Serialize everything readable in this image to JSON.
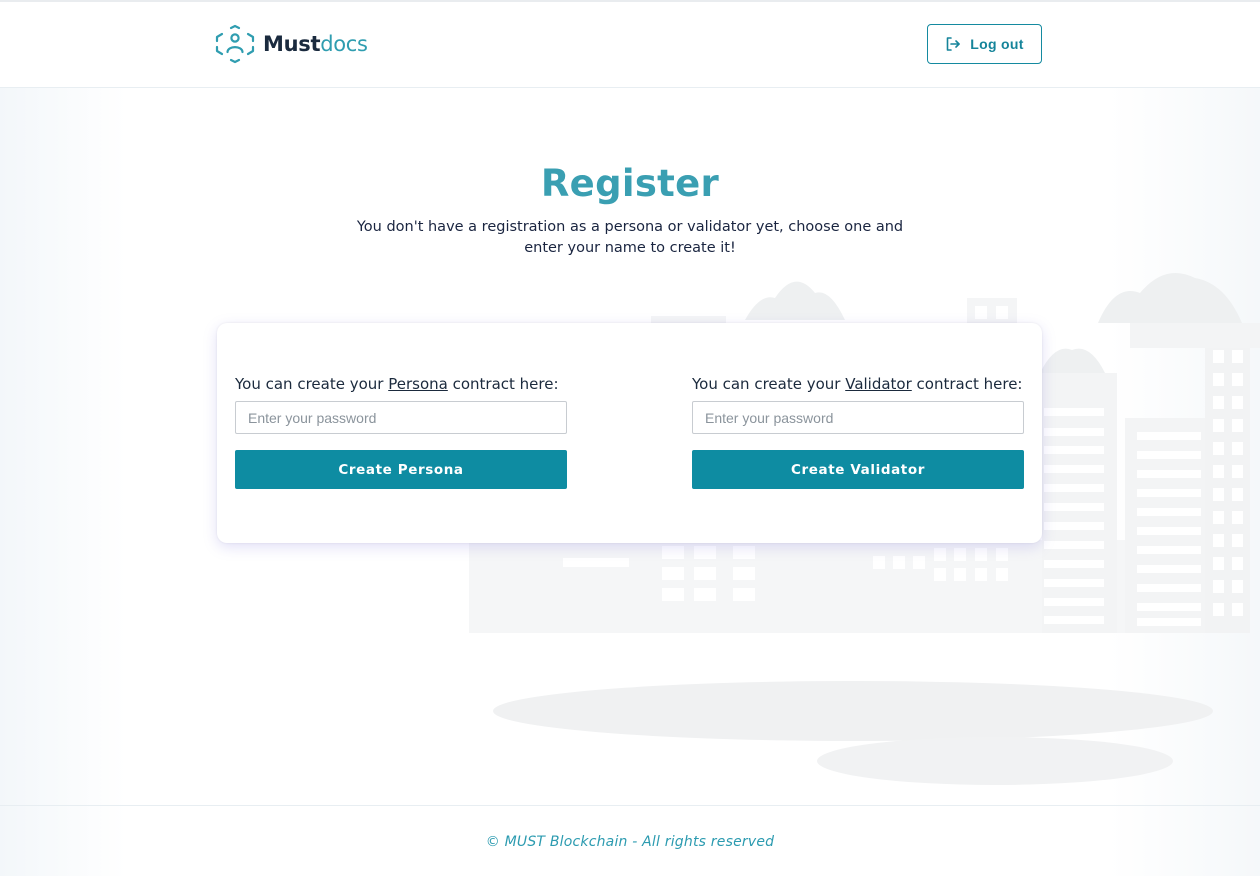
{
  "header": {
    "logo_primary": "Must",
    "logo_secondary": "docs",
    "logout_label": "Log out"
  },
  "main": {
    "title": "Register",
    "subtitle": "You don't have a registration as a persona or validator yet, choose one and enter your name to create it!",
    "persona": {
      "label_prefix": "You can create your ",
      "label_link": "Persona",
      "label_suffix": " contract here:",
      "placeholder": "Enter your password",
      "button_label": "Create Persona"
    },
    "validator": {
      "label_prefix": "You can create your ",
      "label_link": "Validator",
      "label_suffix": " contract here:",
      "placeholder": "Enter your password",
      "button_label": "Create Validator"
    }
  },
  "footer": {
    "copyright": "© MUST Blockchain - All rights reserved"
  },
  "colors": {
    "accent": "#0e8ca2",
    "title": "#3a9fb2",
    "logo_dark": "#1a2a3e",
    "logo_light": "#2f9db0"
  },
  "icons": {
    "logo": "person-hexagon-icon",
    "logout": "logout-arrow-icon"
  }
}
